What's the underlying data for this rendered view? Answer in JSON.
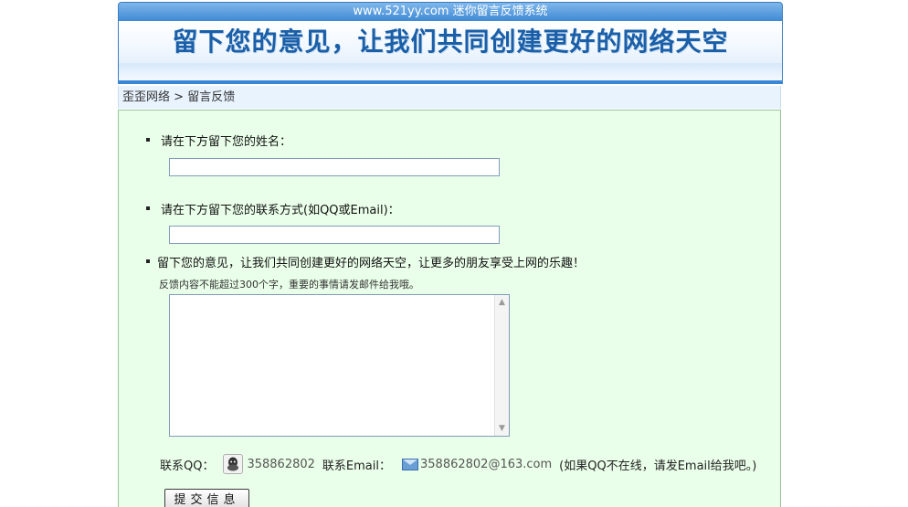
{
  "header": {
    "site_title": "www.521yy.com 迷你留言反馈系统",
    "slogan": "留下您的意见，让我们共同创建更好的网络天空"
  },
  "breadcrumb": {
    "home": "歪歪网络",
    "separator": ">",
    "current": "留言反馈"
  },
  "form": {
    "name_label": "请在下方留下您的姓名：",
    "name_value": "",
    "contact_label": "请在下方留下您的联系方式(如QQ或Email)：",
    "contact_value": "",
    "message_label": "留下您的意见，让我们共同创建更好的网络天空，让更多的朋友享受上网的乐趣！",
    "message_hint": "反馈内容不能超过300个字，重要的事情请发邮件给我哦。",
    "message_value": "",
    "submit_label": "提交信息"
  },
  "contact_info": {
    "qq_label": "联系QQ：",
    "qq_value": "358862802",
    "email_label": "联系Email：",
    "email_value": "358862802@163.com",
    "note": "(如果QQ不在线，请发Email给我吧。)"
  },
  "colors": {
    "header_blue": "#3f8ad6",
    "slogan_blue": "#1a5fa8",
    "content_bg": "#eaffea"
  }
}
